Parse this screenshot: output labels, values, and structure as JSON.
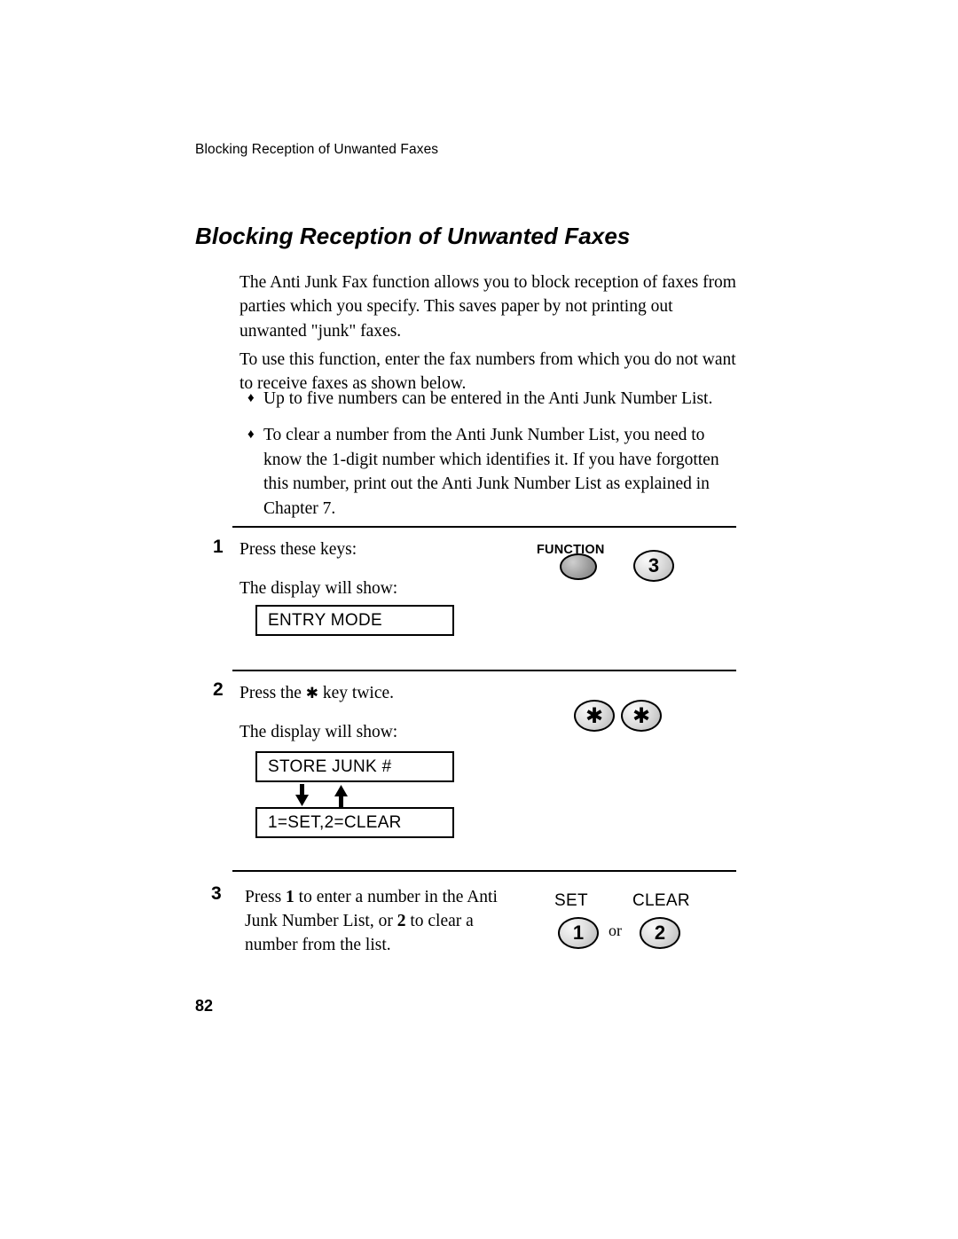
{
  "document": {
    "running_head": "Blocking Reception of Unwanted Faxes",
    "title": "Blocking Reception of Unwanted Faxes",
    "page_number": "82",
    "paragraphs": {
      "intro1": "The Anti Junk Fax function allows you to block reception of faxes from parties which you specify. This saves paper by not printing out unwanted \"junk\" faxes.",
      "intro2": "To use this function, enter the fax numbers from which you do not want to receive faxes as shown below."
    },
    "bullets": [
      {
        "marker": "♦",
        "text": "Up to five numbers can be entered in the Anti Junk Number List."
      },
      {
        "marker": "♦",
        "text": "To clear a number from the Anti Junk Number List, you need to know the 1-digit number which identifies it. If you have forgotten this number, print out the Anti Junk Number List as explained in Chapter 7."
      }
    ],
    "steps": [
      {
        "number": "1",
        "instruction": "Press these keys:",
        "display_label": "The display will show:",
        "display_text": "ENTRY MODE",
        "keys": {
          "function_label": "FUNCTION",
          "digit": "3"
        }
      },
      {
        "number": "2",
        "instruction_before": "Press the",
        "instruction_star": "✱",
        "instruction_after": "key twice.",
        "display_label": "The display will show:",
        "display_text_1": "STORE JUNK #",
        "display_text_2": "1=SET,2=CLEAR",
        "keys": {
          "star_1": "✱",
          "star_2": "✱"
        }
      },
      {
        "number": "3",
        "text_part_1": "Press ",
        "text_bold_1": "1",
        "text_part_2": " to enter a number in the Anti Junk Number List, or ",
        "text_bold_2": "2",
        "text_part_3": " to clear a number from the list.",
        "keys": {
          "set_label": "SET",
          "clear_label": "CLEAR",
          "digit_1": "1",
          "or": "or",
          "digit_2": "2"
        }
      }
    ]
  }
}
